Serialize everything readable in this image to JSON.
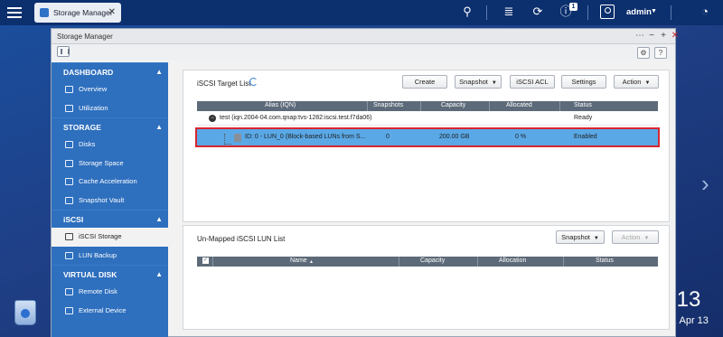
{
  "taskbar": {
    "app_tab_label": "Storage Manager",
    "notification_count": "1",
    "user_name": "admin"
  },
  "desktop": {
    "clock": ":13",
    "date": ", Apr 13"
  },
  "window": {
    "title": "Storage Manager"
  },
  "sidebar": {
    "sections": [
      {
        "label": "DASHBOARD",
        "items": [
          {
            "label": "Overview"
          },
          {
            "label": "Utilization"
          }
        ]
      },
      {
        "label": "STORAGE",
        "items": [
          {
            "label": "Disks"
          },
          {
            "label": "Storage Space"
          },
          {
            "label": "Cache Acceleration"
          },
          {
            "label": "Snapshot Vault"
          }
        ]
      },
      {
        "label": "iSCSI",
        "items": [
          {
            "label": "iSCSI Storage"
          },
          {
            "label": "LUN Backup"
          }
        ]
      },
      {
        "label": "VIRTUAL DISK",
        "items": [
          {
            "label": "Remote Disk"
          },
          {
            "label": "External Device"
          }
        ]
      }
    ],
    "active_item": "iSCSI Storage"
  },
  "target_panel": {
    "title": "iSCSI Target List",
    "buttons": {
      "create": "Create",
      "snapshot": "Snapshot",
      "iscsi_acl": "iSCSI ACL",
      "settings": "Settings",
      "action": "Action"
    },
    "columns": [
      "Alias (IQN)",
      "Snapshots",
      "Capacity",
      "Allocated",
      "Status"
    ],
    "target_row": {
      "alias": "test (iqn.2004-04.com.qnap:tvs-1282:iscsi.test.f7da06)",
      "status": "Ready"
    },
    "lun_row": {
      "alias": "ID: 0 - LUN_0 (Block-based LUNs from S...",
      "snapshots": "0",
      "capacity": "200.00 GB",
      "allocated": "0 %",
      "status": "Enabled"
    }
  },
  "unmapped_panel": {
    "title": "Un-Mapped iSCSI LUN List",
    "buttons": {
      "snapshot": "Snapshot",
      "action": "Action"
    },
    "columns": [
      "Name",
      "Capacity",
      "Allocation",
      "Status"
    ],
    "sort_indicator": "▲"
  }
}
